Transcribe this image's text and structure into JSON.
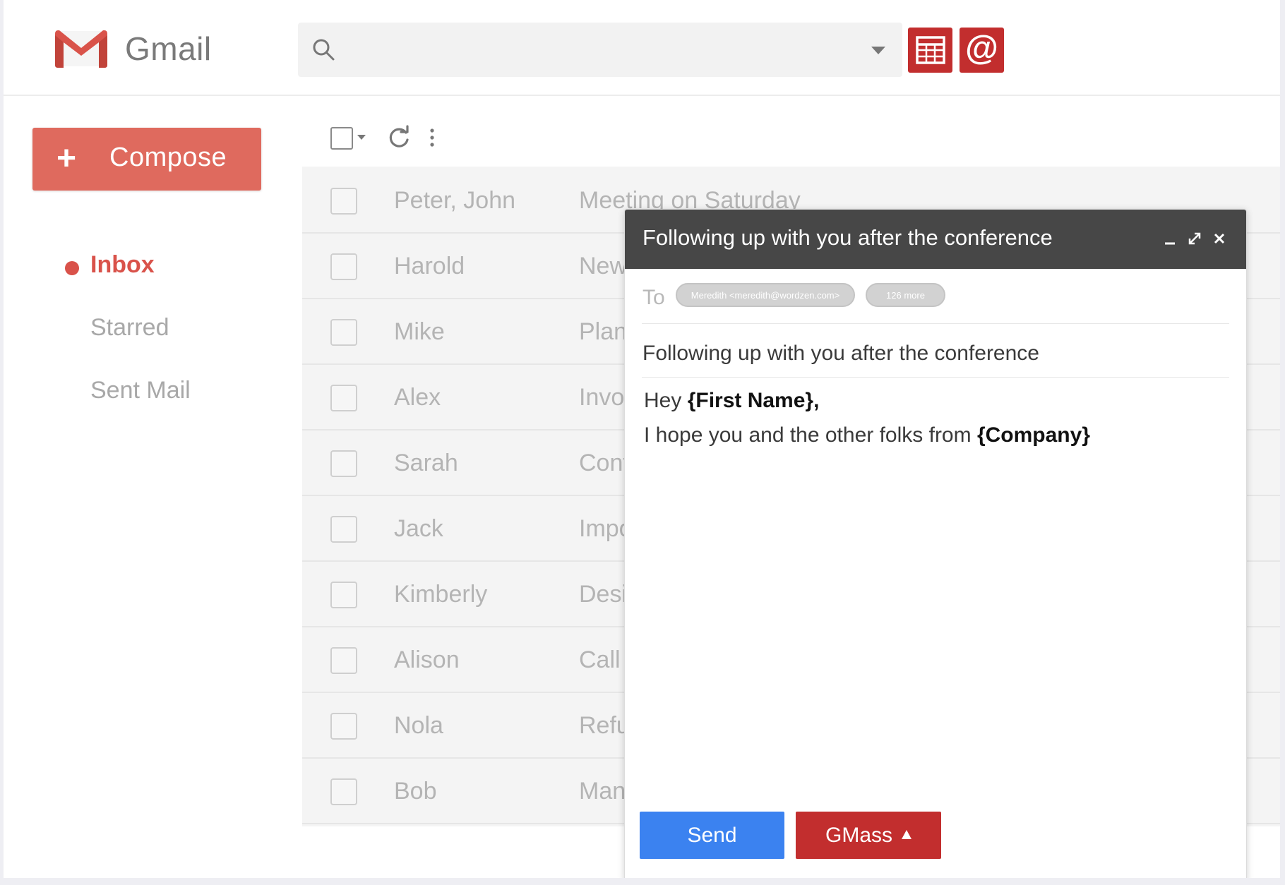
{
  "header": {
    "brand": "Gmail",
    "search": {
      "placeholder": "",
      "value": ""
    },
    "buttons": [
      {
        "icon": "spreadsheet-icon"
      },
      {
        "icon": "at-sign-icon",
        "glyph": "@"
      }
    ]
  },
  "sidebar": {
    "compose_label": "Compose",
    "compose_plus": "+",
    "items": [
      {
        "label": "Inbox",
        "active": true
      },
      {
        "label": "Starred",
        "active": false
      },
      {
        "label": "Sent Mail",
        "active": false
      }
    ]
  },
  "list": {
    "rows": [
      {
        "sender": "Peter, John",
        "subject": "Meeting on Saturday"
      },
      {
        "sender": "Harold",
        "subject": "New"
      },
      {
        "sender": "Mike",
        "subject": "Plan"
      },
      {
        "sender": "Alex",
        "subject": "Invo"
      },
      {
        "sender": "Sarah",
        "subject": "Cont"
      },
      {
        "sender": "Jack",
        "subject": "Impo"
      },
      {
        "sender": "Kimberly",
        "subject": "Desi"
      },
      {
        "sender": "Alison",
        "subject": "Call"
      },
      {
        "sender": "Nola",
        "subject": "Refu"
      },
      {
        "sender": "Bob",
        "subject": "Man"
      }
    ]
  },
  "compose_window": {
    "title": "Following up with you after the conference",
    "to_label": "To",
    "recipients": [
      "Meredith <meredith@wordzen.com>",
      "126 more"
    ],
    "subject": "Following up with you after the conference",
    "body": {
      "line1_prefix": "Hey ",
      "line1_token": "{First Name},",
      "line2_prefix": "I hope you and the other folks from ",
      "line2_token": "{Company}"
    },
    "send_label": "Send",
    "gmass_label": "GMass"
  },
  "colors": {
    "accent_red": "#c22e2e",
    "compose_red": "#df6a5e",
    "inbox_red": "#d9524a",
    "send_blue": "#3b82f0",
    "compose_header": "#474747"
  }
}
